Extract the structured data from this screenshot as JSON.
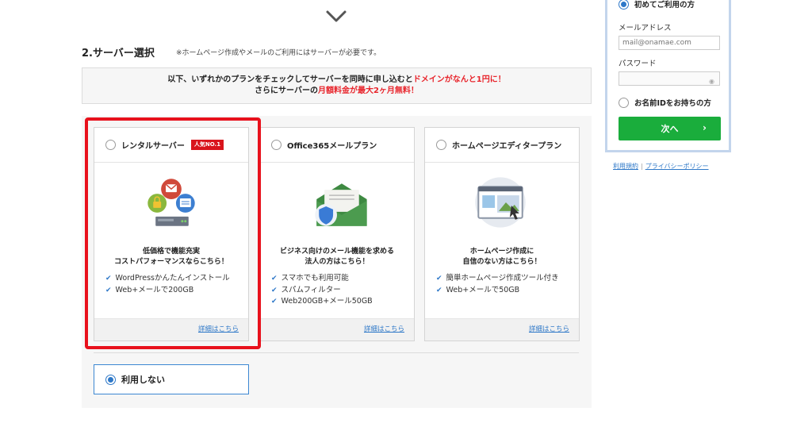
{
  "section": {
    "title": "2.サーバー選択",
    "note": "※ホームページ作成やメールのご利用にはサーバーが必要です。"
  },
  "notice": {
    "line1_pre": "以下、いずれかのプランをチェックしてサーバーを同時に申し込むと",
    "line1_red": "ドメインがなんと1円に！",
    "line2_pre": "さらにサーバーの",
    "line2_red": "月額料金が最大2ヶ月無料！"
  },
  "plans": [
    {
      "name": "レンタルサーバー",
      "badge": "人気NO.1",
      "desc1": "低価格で機能充実",
      "desc2": "コストパフォーマンスならこちら！",
      "features": [
        "WordPressかんたんインストール",
        "Web+メールで200GB"
      ],
      "detail_link": "詳細はこちら"
    },
    {
      "name": "Office365メールプラン",
      "desc1": "ビジネス向けのメール機能を求める",
      "desc2": "法人の方はこちら！",
      "features": [
        "スマホでも利用可能",
        "スパムフィルター",
        "Web200GB+メール50GB"
      ],
      "detail_link": "詳細はこちら"
    },
    {
      "name": "ホームページエディタープラン",
      "desc1": "ホームページ作成に",
      "desc2": "自信のない方はこちら！",
      "features": [
        "簡単ホームページ作成ツール付き",
        "Web+メールで50GB"
      ],
      "detail_link": "詳細はこちら"
    }
  ],
  "no_use": {
    "label": "利用しない",
    "selected": true
  },
  "login": {
    "first_time": "初めてご利用の方",
    "email_label": "メールアドレス",
    "email_placeholder": "mail@onamae.com",
    "password_label": "パスワード",
    "has_id": "お名前IDをお持ちの方",
    "next_label": "次へ",
    "next_arrow": "›"
  },
  "footer_links": {
    "terms": "利用規約",
    "privacy": "プライバシーポリシー"
  },
  "colors": {
    "accent_red": "#e8242b",
    "frame_red": "#e8111c",
    "link_blue": "#2e78c8",
    "button_green": "#1aad3c"
  }
}
